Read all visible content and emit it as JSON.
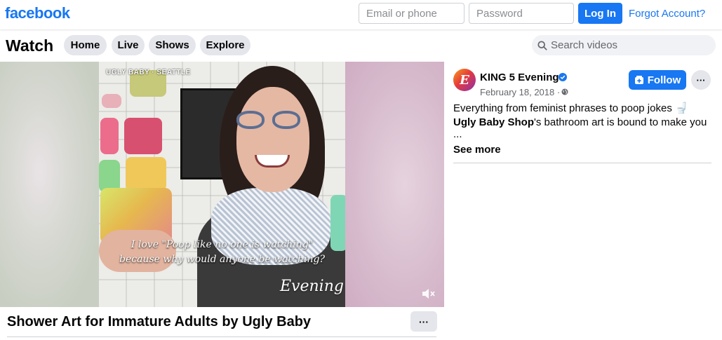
{
  "header": {
    "logo": "facebook",
    "email_placeholder": "Email or phone",
    "password_placeholder": "Password",
    "login_label": "Log In",
    "forgot_label": "Forgot Account?"
  },
  "watch": {
    "title": "Watch",
    "tabs": [
      {
        "label": "Home"
      },
      {
        "label": "Live"
      },
      {
        "label": "Shows"
      },
      {
        "label": "Explore"
      }
    ],
    "search_placeholder": "Search videos"
  },
  "video": {
    "overlay_tag": "UGLY BABY · SEATTLE",
    "caption_line1": "I love \"Poop like no one is watching\"",
    "caption_line2": "because why would anyone be watching?",
    "brand_watermark": "Evening",
    "title": "Shower Art for Immature Adults by Ugly Baby",
    "more_label": "···"
  },
  "post": {
    "avatar_letter": "E",
    "page_name": "KING 5 Evening",
    "date": "February 18, 2018 ·",
    "follow_label": "Follow",
    "more_label": "···",
    "desc_line1": "Everything from feminist phrases to poop jokes 🚽",
    "desc_bold": "Ugly Baby Shop",
    "desc_rest": "'s bathroom art is bound to make you",
    "desc_ellipsis": "...",
    "see_more": "See more"
  },
  "colors": {
    "brand_blue": "#1877f2",
    "pill_gray": "#e4e6eb",
    "search_bg": "#f0f2f5",
    "secondary_text": "#65676b"
  }
}
